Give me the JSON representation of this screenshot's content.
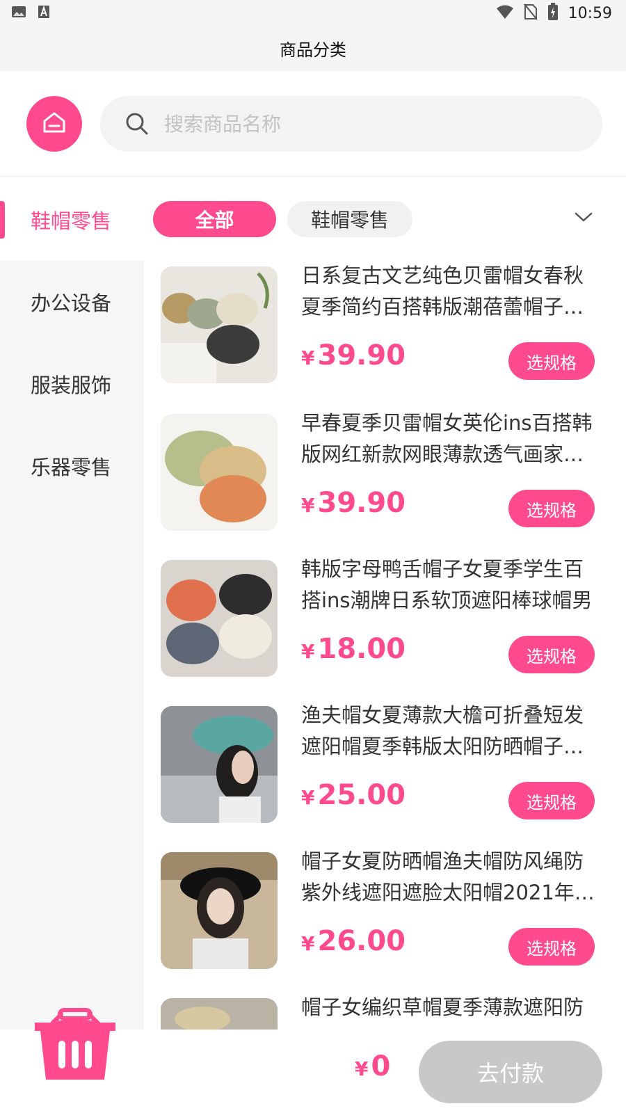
{
  "status_bar": {
    "time": "10:59",
    "left_icons": [
      "image-icon",
      "font-icon"
    ],
    "right_icons": [
      "wifi-icon",
      "no-sim-icon",
      "battery-icon"
    ]
  },
  "header": {
    "title": "商品分类"
  },
  "search": {
    "placeholder": "搜索商品名称",
    "value": ""
  },
  "sidebar": {
    "items": [
      {
        "label": "鞋帽零售",
        "active": true
      },
      {
        "label": "办公设备",
        "active": false
      },
      {
        "label": "服装服饰",
        "active": false
      },
      {
        "label": "乐器零售",
        "active": false
      }
    ]
  },
  "filters": {
    "chips": [
      {
        "label": "全部",
        "active": true
      },
      {
        "label": "鞋帽零售",
        "active": false
      }
    ]
  },
  "products": [
    {
      "name": "日系复古文艺纯色贝雷帽女春秋夏季简约百搭韩版潮蓓蕾帽子…",
      "currency": "¥",
      "price": "39.90",
      "button": "选规格"
    },
    {
      "name": "早春夏季贝雷帽女英伦ins百搭韩版网红新款网眼薄款透气画家…",
      "currency": "¥",
      "price": "39.90",
      "button": "选规格"
    },
    {
      "name": "韩版字母鸭舌帽子女夏季学生百搭ins潮牌日系软顶遮阳棒球帽男",
      "currency": "¥",
      "price": "18.00",
      "button": "选规格"
    },
    {
      "name": "渔夫帽女夏薄款大檐可折叠短发遮阳帽夏季韩版太阳防晒帽子…",
      "currency": "¥",
      "price": "25.00",
      "button": "选规格"
    },
    {
      "name": "帽子女夏防晒帽渔夫帽防风绳防紫外线遮阳遮脸太阳帽2021年…",
      "currency": "¥",
      "price": "26.00",
      "button": "选规格"
    },
    {
      "name": "帽子女编织草帽夏季薄款遮阳防",
      "currency": "",
      "price": "",
      "button": ""
    }
  ],
  "bottom": {
    "currency": "¥",
    "total": "0",
    "pay_label": "去付款"
  },
  "colors": {
    "accent": "#ff4a8d",
    "pay_disabled": "#c8c8c8",
    "sidebar_bg": "#f6f6f6"
  }
}
